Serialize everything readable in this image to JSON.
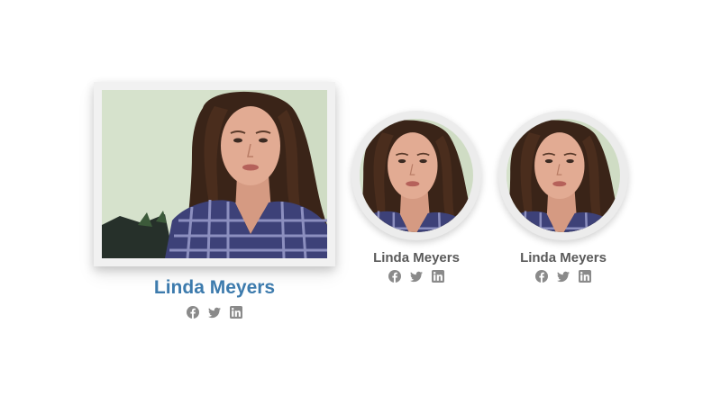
{
  "profiles": [
    {
      "name": "Linda Meyers",
      "name_color": "#3d7bad",
      "photo_shape": "rectangle",
      "social": [
        "facebook-icon",
        "twitter-icon",
        "linkedin-icon"
      ]
    },
    {
      "name": "Linda Meyers",
      "name_color": "#5a5a5a",
      "photo_shape": "circle",
      "social": [
        "facebook-icon",
        "twitter-icon",
        "linkedin-icon"
      ]
    },
    {
      "name": "Linda Meyers",
      "name_color": "#5a5a5a",
      "photo_shape": "circle",
      "social": [
        "facebook-icon",
        "twitter-icon",
        "linkedin-icon"
      ]
    }
  ],
  "colors": {
    "accent": "#3d7bad",
    "text_muted": "#5a5a5a",
    "icon": "#8a8a8a",
    "frame": "#f1f1f1"
  }
}
